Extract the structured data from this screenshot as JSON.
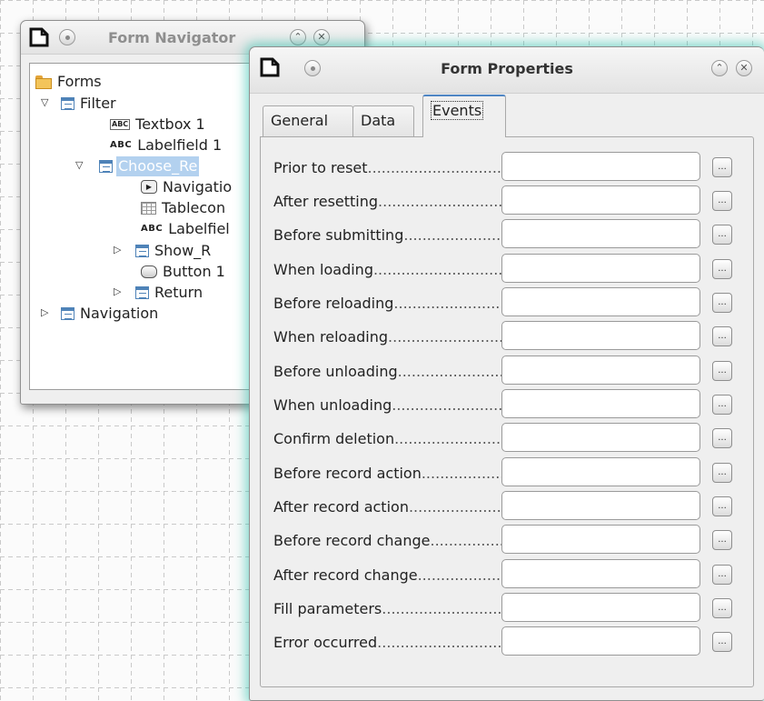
{
  "navigator": {
    "title": "Form Navigator",
    "items": [
      {
        "label": "Forms",
        "icon": "folder-icon",
        "level": 0
      },
      {
        "label": "Filter",
        "icon": "form-icon",
        "level": 1,
        "expanded": true
      },
      {
        "label": "Textbox 1",
        "icon": "textbox-icon",
        "level": 2
      },
      {
        "label": "Labelfield 1",
        "icon": "label-icon",
        "level": 2
      },
      {
        "label": "Choose_Re",
        "icon": "form-icon",
        "level": 2,
        "expanded": true,
        "selected": true
      },
      {
        "label": "Navigatio",
        "icon": "navigation-bar-icon",
        "level": 3
      },
      {
        "label": "Tablecon",
        "icon": "table-control-icon",
        "level": 3
      },
      {
        "label": "Labelfiel",
        "icon": "label-icon",
        "level": 3
      },
      {
        "label": "Show_R",
        "icon": "form-icon",
        "level": 3,
        "expanded": false
      },
      {
        "label": "Button 1",
        "icon": "button-icon",
        "level": 3
      },
      {
        "label": "Return",
        "icon": "form-icon",
        "level": 2,
        "expanded": false
      },
      {
        "label": "Navigation",
        "icon": "form-icon",
        "level": 0,
        "expanded": false
      }
    ]
  },
  "properties": {
    "title": "Form Properties",
    "tabs": [
      {
        "label": "General",
        "active": false
      },
      {
        "label": "Data",
        "active": false
      },
      {
        "label": "Events",
        "active": true
      }
    ],
    "events": [
      {
        "label": "Prior to reset",
        "value": "",
        "button": "..."
      },
      {
        "label": "After resetting",
        "value": "",
        "button": "..."
      },
      {
        "label": "Before submitting",
        "value": "",
        "button": "..."
      },
      {
        "label": "When loading",
        "value": "",
        "button": "..."
      },
      {
        "label": "Before reloading",
        "value": "",
        "button": "..."
      },
      {
        "label": "When reloading",
        "value": "",
        "button": "..."
      },
      {
        "label": "Before unloading",
        "value": "",
        "button": "..."
      },
      {
        "label": "When unloading",
        "value": "",
        "button": "..."
      },
      {
        "label": "Confirm deletion",
        "value": "",
        "button": "..."
      },
      {
        "label": "Before record action",
        "value": "",
        "button": "..."
      },
      {
        "label": "After record action",
        "value": "",
        "button": "..."
      },
      {
        "label": "Before record change",
        "value": "",
        "button": "..."
      },
      {
        "label": "After record change",
        "value": "",
        "button": "..."
      },
      {
        "label": "Fill parameters",
        "value": "",
        "button": "..."
      },
      {
        "label": "Error occurred",
        "value": "",
        "button": "..."
      }
    ]
  },
  "colors": {
    "selection": "#b3d1ef",
    "dialog_glow": "#28bea8",
    "active_tab_accent": "#4f86c4"
  }
}
